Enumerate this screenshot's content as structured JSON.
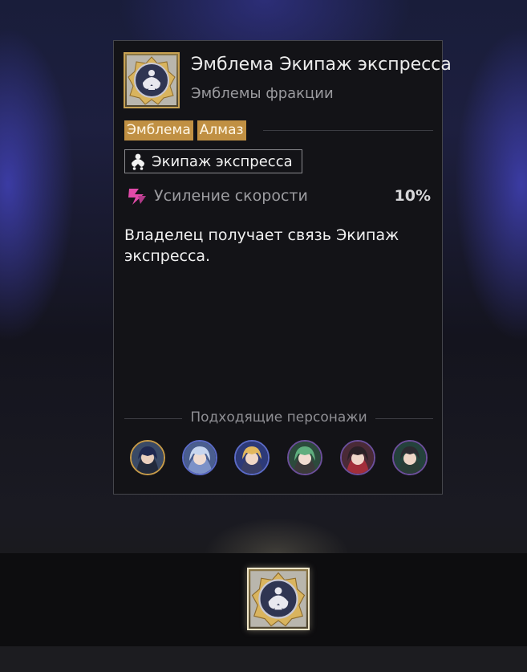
{
  "item": {
    "name": "Эмблема Экипаж экспресса",
    "category": "Эмблемы фракции",
    "icon": "express-crew-emblem-icon"
  },
  "tags": [
    {
      "label": "Эмблема"
    },
    {
      "label": "Алмаз"
    }
  ],
  "faction": {
    "label": "Экипаж экспресса",
    "icon": "express-crew-icon"
  },
  "stat": {
    "name": "Усиление скорости",
    "value": "10%",
    "icon": "speed-boost-icon",
    "icon_color": "#e04aa8"
  },
  "description": "Владелец получает связь Экипаж экспресса.",
  "suitable_characters": {
    "title": "Подходящие персонажи",
    "avatars": [
      {
        "icon": "character-portrait-icon",
        "frame": "gold"
      },
      {
        "icon": "character-portrait-icon",
        "frame": "blue"
      },
      {
        "icon": "character-portrait-icon",
        "frame": "blue"
      },
      {
        "icon": "character-portrait-icon",
        "frame": "violet"
      },
      {
        "icon": "character-portrait-icon",
        "frame": "violet"
      },
      {
        "icon": "character-portrait-icon",
        "frame": "violet"
      }
    ]
  },
  "colors": {
    "tag_bg": "#c09043",
    "card_bg": "#131317",
    "frame_gold": "#c59a49",
    "frame_blue": "#5b6bc8",
    "frame_violet": "#6c4f9b"
  },
  "selected_slot": {
    "icon": "express-crew-emblem-icon"
  }
}
